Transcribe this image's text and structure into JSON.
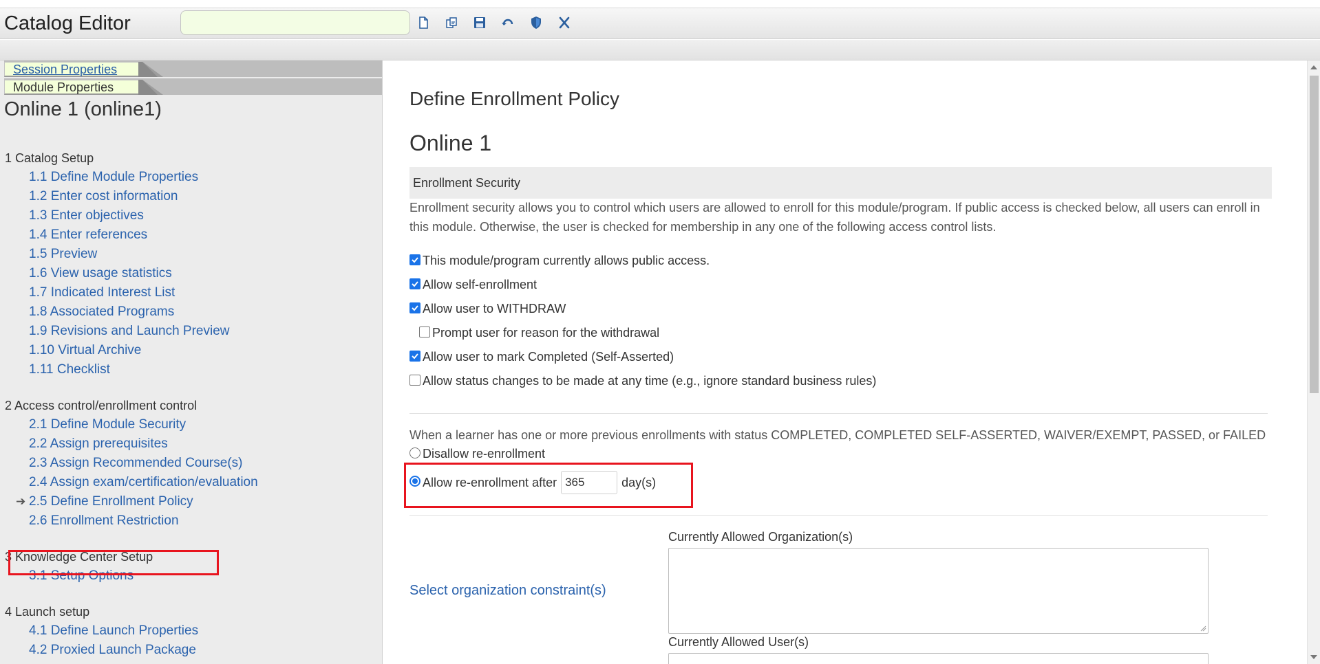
{
  "app": {
    "title": "Catalog Editor",
    "search_value": ""
  },
  "toolbar": {
    "icons": [
      "new-document-icon",
      "copy-icon",
      "save-icon",
      "undo-icon",
      "shield-icon",
      "close-x-icon"
    ]
  },
  "left": {
    "tabs": [
      "Session Properties",
      "Module Properties"
    ],
    "module_name": "Online 1 (online1)",
    "sections": [
      {
        "title": "1 Catalog Setup",
        "items": [
          "1.1 Define Module Properties",
          "1.2 Enter cost information",
          "1.3 Enter objectives",
          "1.4 Enter references",
          "1.5 Preview",
          "1.6 View usage statistics",
          "1.7 Indicated Interest List",
          "1.8 Associated Programs",
          "1.9 Revisions and Launch Preview",
          "1.10 Virtual Archive",
          "1.11 Checklist"
        ]
      },
      {
        "title": "2 Access control/enrollment control",
        "items": [
          "2.1 Define Module Security",
          "2.2 Assign prerequisites",
          "2.3 Assign Recommended Course(s)",
          "2.4 Assign exam/certification/evaluation",
          "2.5 Define Enrollment Policy",
          "2.6 Enrollment Restriction"
        ]
      },
      {
        "title": "3 Knowledge Center Setup",
        "items": [
          "3.1 Setup Options"
        ]
      },
      {
        "title": "4 Launch setup",
        "items": [
          "4.1 Define Launch Properties",
          "4.2 Proxied Launch Package"
        ]
      }
    ],
    "current_item": "2.5 Define Enrollment Policy"
  },
  "main": {
    "page_title": "Define Enrollment Policy",
    "module_title": "Online 1",
    "section_header": "Enrollment Security",
    "description": "Enrollment security allows you to control which users are allowed to enroll for this module/program. If public access is checked below, all users can enroll in this module. Otherwise, the user is checked for membership in any one of the following access control lists.",
    "options": [
      {
        "label": "This module/program currently allows public access.",
        "checked": true
      },
      {
        "label": "Allow self-enrollment",
        "checked": true
      },
      {
        "label": "Allow user to WITHDRAW",
        "checked": true
      },
      {
        "label": "Prompt user for reason for the withdrawal",
        "checked": false
      },
      {
        "label": "Allow user to mark Completed (Self-Asserted)",
        "checked": true
      },
      {
        "label": "Allow status changes to be made at any time (e.g., ignore standard business rules)",
        "checked": false
      }
    ],
    "reenroll_text": "When a learner has one or more previous enrollments with status COMPLETED, COMPLETED SELF-ASSERTED, WAIVER/EXEMPT, PASSED, or FAILED",
    "disallow_label": "Disallow re-enrollment",
    "allow_label": "Allow re-enrollment after",
    "allow_days": "365",
    "days_unit": "day(s)",
    "selected_reenroll": "allow",
    "org_link": "Select organization constraint(s)",
    "orgs_label": "Currently Allowed Organization(s)",
    "users_label": "Currently Allowed User(s)"
  },
  "colors": {
    "link": "#2a62ad",
    "highlight": "#e8141e",
    "checkbox": "#1a73e8",
    "tab_bg": "#f4ffd9"
  }
}
